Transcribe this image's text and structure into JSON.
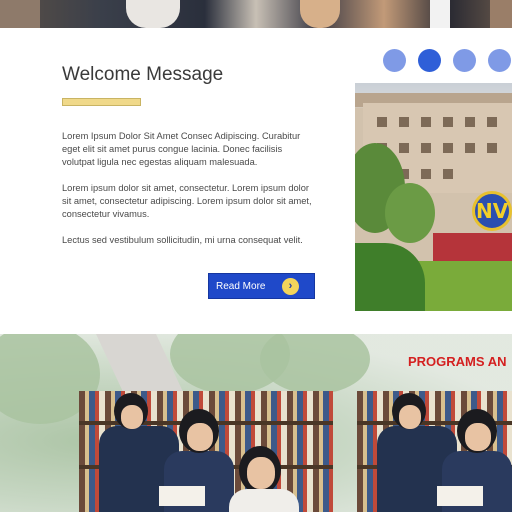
{
  "welcome": {
    "title": "Welcome Message",
    "paragraph_1": "Lorem Ipsum Dolor Sit Amet Consec Adipiscing. Curabitur eget elit sit amet purus congue lacinia. Donec facilisis volutpat ligula nec egestas aliquam malesuada.",
    "paragraph_2": "Lorem ipsum dolor sit amet, consectetur. Lorem ipsum dolor sit amet, consectetur adipiscing. Lorem ipsum dolor sit amet, consectetur vivamus.",
    "paragraph_3": "Lectus sed vestibulum sollicitudin, mi urna consequat velit.",
    "read_more_label": "Read More",
    "read_more_icon": "chevron-right-icon"
  },
  "slider": {
    "dot_count": 4,
    "active_index": 1
  },
  "campus_image": {
    "logo_text": "NV"
  },
  "programs": {
    "title": "PROGRAMS AN"
  },
  "colors": {
    "accent_blue": "#1f49c9",
    "accent_yellow": "#f3d55b",
    "programs_red": "#d42020"
  }
}
